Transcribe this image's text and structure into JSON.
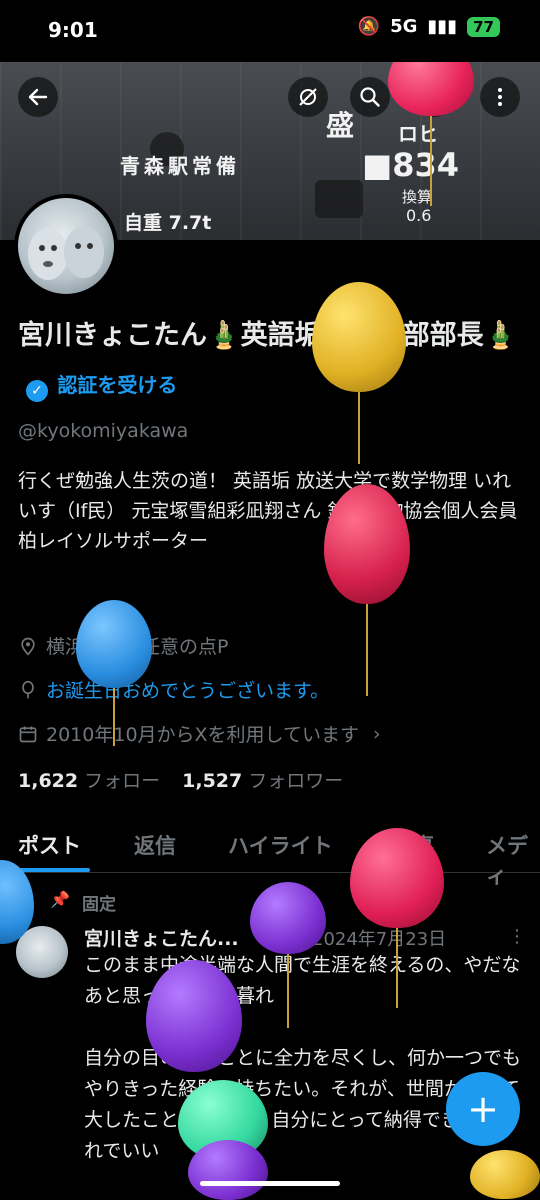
{
  "status_bar": {
    "time": "9:01",
    "network": "5G",
    "battery": "77"
  },
  "banner": {
    "station_text": "青森駅常備",
    "weight_text": "自重 7.7t",
    "emblem_text": "盛",
    "small_text": "ロヒ",
    "number_text": "■834",
    "conversion_label": "換算",
    "conversion_value": "0.6"
  },
  "profile": {
    "display_name": "宮川きょこたん🎍英語垢捨て活部部長🎍",
    "verify_label": "認証を受ける",
    "handle": "@kyokomiyakawa",
    "bio": "行くぜ勉強人生茨の道！ 英語垢 放送大学で数学物理 いれいす（If民） 元宝塚雪組彩凪翔さん 鉄道貨物協会個人会員 柏レイソルサポーター",
    "location": "横浜市内の任意の点P",
    "birthday": "お誕生日おめでとうございます。",
    "joined": "2010年10月からXを利用しています",
    "following_count": "1,622",
    "following_label": "フォロー",
    "followers_count": "1,527",
    "followers_label": "フォロワー"
  },
  "tabs": [
    "ポスト",
    "返信",
    "ハイライト",
    "記事",
    "メディ"
  ],
  "pinned_post": {
    "pinned_label": "固定",
    "author": "宮川きょこたん...",
    "date": "2024年7月23日",
    "body": "このまま中途半端な人間で生涯を終えるの、やだなあと思った夏の夕暮れ\n\n自分の目の前のことに全力を尽くし、何か一つでもやりきった経験を持ちたい。それが、世間からみて大したことなくても、自分にとって納得できればそれでいい"
  },
  "fab_label": "+",
  "colors": {
    "accent": "#1d9bf0",
    "background": "#000000",
    "text": "#e7e9ea",
    "secondary_text": "#71767b",
    "balloon_colors": [
      "#e8245a",
      "#e0b024",
      "#d5204c",
      "#2a8ee0",
      "#7b2fd0",
      "#35d8a0"
    ]
  },
  "icons": [
    "back-arrow-icon",
    "no-sync-icon",
    "search-icon",
    "edit-icon",
    "more-icon",
    "location-pin-icon",
    "birthday-balloon-icon",
    "calendar-icon",
    "pin-icon",
    "plus-icon"
  ]
}
